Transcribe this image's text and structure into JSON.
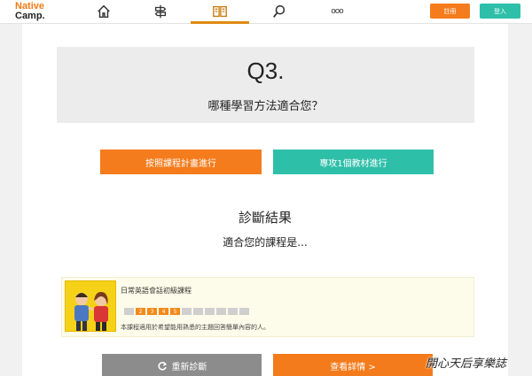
{
  "header": {
    "logo_line1": "Native",
    "logo_line2": "Camp.",
    "nav_icons": [
      "home-icon",
      "signpost-icon",
      "book-icon",
      "search-icon",
      "more-icon"
    ],
    "more_glyph": "ooo",
    "login_label": "註冊",
    "signup_label": "登入",
    "accent": "#e08a12",
    "login_color": "#f47c1c",
    "signup_color": "#2ebfa9"
  },
  "question": {
    "number": "Q3.",
    "text": "哪種學習方法適合您？"
  },
  "choices": {
    "a": "按照課程計畫進行",
    "b": "專攻1個教材進行"
  },
  "result": {
    "title": "診斷結果",
    "subtitle": "適合您的課程是..."
  },
  "course": {
    "title": "日常英語會話初級課程",
    "levels": [
      "",
      "2",
      "3",
      "4",
      "5",
      "",
      "",
      "",
      "",
      "",
      ""
    ],
    "active_levels": [
      2,
      3,
      4,
      5
    ],
    "description": "本課程適用於希望能用熟悉的主題回答簡單內容的人。"
  },
  "actions": {
    "retry_label": "重新診斷",
    "detail_label": "查看詳情 >"
  },
  "watermark": "開心天后享樂誌"
}
